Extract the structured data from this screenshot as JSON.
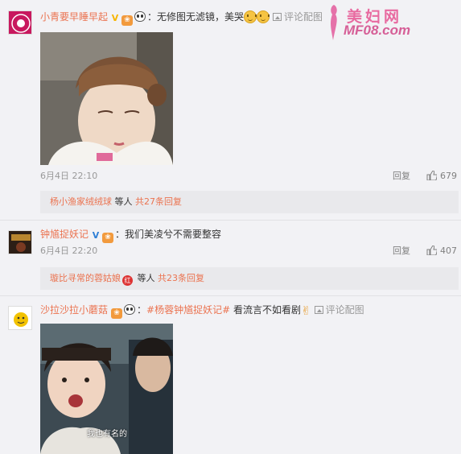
{
  "watermark": {
    "cn": "美妇网",
    "en": "MF08.com"
  },
  "comments": [
    {
      "user": "小青要早睡早起",
      "avatar_icon": "pink-round-logo-avatar",
      "text_prefix": "：无修图无滤镜，美哭",
      "pic_link": "评论配图",
      "photo_icon": "portrait-photo-woman-bangs",
      "time": "6月4日 22:10",
      "reply_label": "回复",
      "likes": "679",
      "sub_reply_user": "杨小渔家绒绒球",
      "sub_reply_mid": " 等人 ",
      "sub_reply_count": "共27条回复"
    },
    {
      "user": "钟馗捉妖记",
      "avatar_icon": "movie-poster-avatar",
      "text_prefix": "：我们美凌兮不需要整容",
      "time": "6月4日 22:20",
      "reply_label": "回复",
      "likes": "407",
      "sub_reply_user": "璇比寻常的蓉姑娘",
      "sub_reply_mid": " 等人 ",
      "sub_reply_count": "共23条回复"
    },
    {
      "user": "沙拉沙拉小蘑菇",
      "avatar_icon": "yellow-cartoon-avatar",
      "text_sep": "：",
      "tag": "#杨蓉钟馗捉妖记#",
      "text_after": " 看流言不如看剧",
      "pic_link": "评论配图",
      "photo_icon": "drama-still-surprised-woman",
      "subtitle": "我也有名的"
    }
  ],
  "colors": {
    "link": "#eb7350",
    "background": "#f2f2f5",
    "muted": "#999999"
  }
}
